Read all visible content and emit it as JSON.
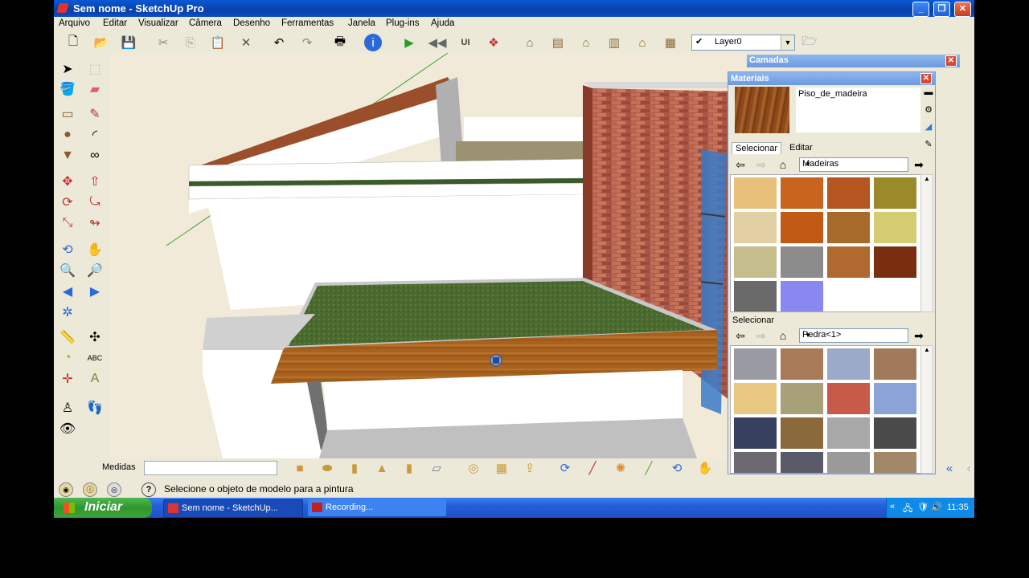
{
  "window": {
    "title": "Sem nome - SketchUp Pro"
  },
  "menu": [
    "Arquivo",
    "Editar",
    "Visualizar",
    "Câmera",
    "Desenho",
    "Ferramentas",
    "Janela",
    "Plug-ins",
    "Ajuda"
  ],
  "layer_selector": {
    "value": "Layer0"
  },
  "layers_panel": {
    "title": "Camadas"
  },
  "materials_panel": {
    "title": "Materiais",
    "current_material": "Piso_de_madeira",
    "tabs": [
      "Selecionar",
      "Editar"
    ],
    "library_top": "Madeiras",
    "secondary_label": "Selecionar",
    "library_bottom": "Pedra<1>",
    "top_swatch_colors": [
      "#e8c07a",
      "#c8641e",
      "#b5551f",
      "#9a8a2a",
      "#e2cfa3",
      "#c05a14",
      "#a86a2a",
      "#d6cc72",
      "#c6bd8c",
      "#8c8c8c",
      "#b06a30",
      "#7a2e10",
      "#6a6a6a",
      "#8888f0"
    ],
    "bottom_swatch_colors": [
      "#9a9aa2",
      "#a87a58",
      "#9aaac8",
      "#a07a5a",
      "#e8c880",
      "#a8a078",
      "#c85a4a",
      "#8aa4d8",
      "#384060",
      "#8a6a3a",
      "#a8a8a8",
      "#4a4a4a",
      "#6a6a70",
      "#5a5a68",
      "#9a9a9a",
      "#a08868"
    ]
  },
  "measurements": {
    "label": "Medidas",
    "value": ""
  },
  "status": {
    "message": "Selecione o objeto de modelo para a pintura"
  },
  "taskbar": {
    "start_label": "Iniciar",
    "tasks": [
      "Sem nome - SketchUp...",
      "Recording..."
    ],
    "clock": "11:35"
  }
}
